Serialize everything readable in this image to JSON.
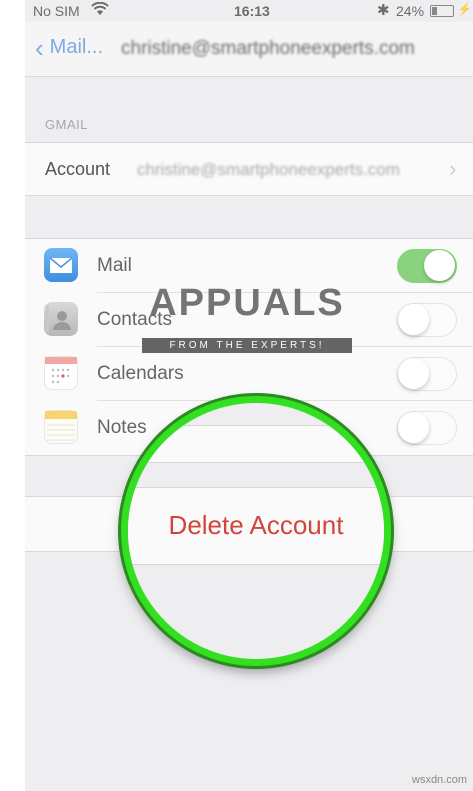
{
  "status_bar": {
    "carrier": "No SIM",
    "time": "16:13",
    "battery": "24%",
    "battery_level": 0.24
  },
  "nav": {
    "back_label": "Mail...",
    "title": "christine@smartphoneexperts.com"
  },
  "section": {
    "label": "GMAIL"
  },
  "account": {
    "label": "Account",
    "value": "christine@smartphoneexperts.com"
  },
  "toggles": [
    {
      "label": "Mail",
      "icon": "mail-icon",
      "on": true
    },
    {
      "label": "Contacts",
      "icon": "contacts-icon",
      "on": false
    },
    {
      "label": "Calendars",
      "icon": "calendars-icon",
      "on": false
    },
    {
      "label": "Notes",
      "icon": "notes-icon",
      "on": false
    }
  ],
  "delete_label": "Delete Account",
  "watermark": {
    "text": "APPUALS",
    "subtitle": "FROM THE EXPERTS!"
  },
  "footer": "wsxdn.com",
  "colors": {
    "accent": "#6f9fe0",
    "toggle_on": "#8bd27f",
    "delete": "#d0453c",
    "magnifier_ring": "#33e021"
  }
}
